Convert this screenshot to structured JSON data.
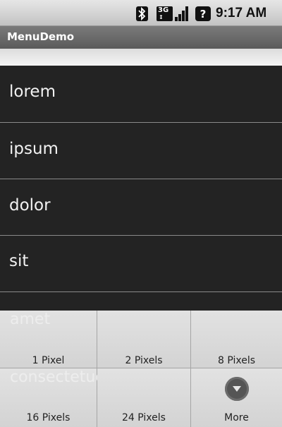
{
  "status_bar": {
    "icons": [
      "bluetooth-icon",
      "3g-icon",
      "signal-icon",
      "help-icon"
    ],
    "network_label": "3G",
    "help_glyph": "?",
    "time": "9:17 AM"
  },
  "app": {
    "title": "MenuDemo"
  },
  "list": {
    "items": [
      "lorem",
      "ipsum",
      "dolor",
      "sit"
    ],
    "hidden_items": [
      "amet",
      "consectetuer"
    ]
  },
  "options_menu": {
    "items": [
      {
        "label": "1 Pixel"
      },
      {
        "label": "2 Pixels"
      },
      {
        "label": "8 Pixels"
      },
      {
        "label": "16 Pixels"
      },
      {
        "label": "24 Pixels"
      },
      {
        "label": "More",
        "icon": "more-icon"
      }
    ]
  },
  "colors": {
    "list_background": "#232323",
    "list_text": "#f2f2f2",
    "menu_background": "#d9d9d9",
    "title_bar": "#6b6b6b"
  }
}
